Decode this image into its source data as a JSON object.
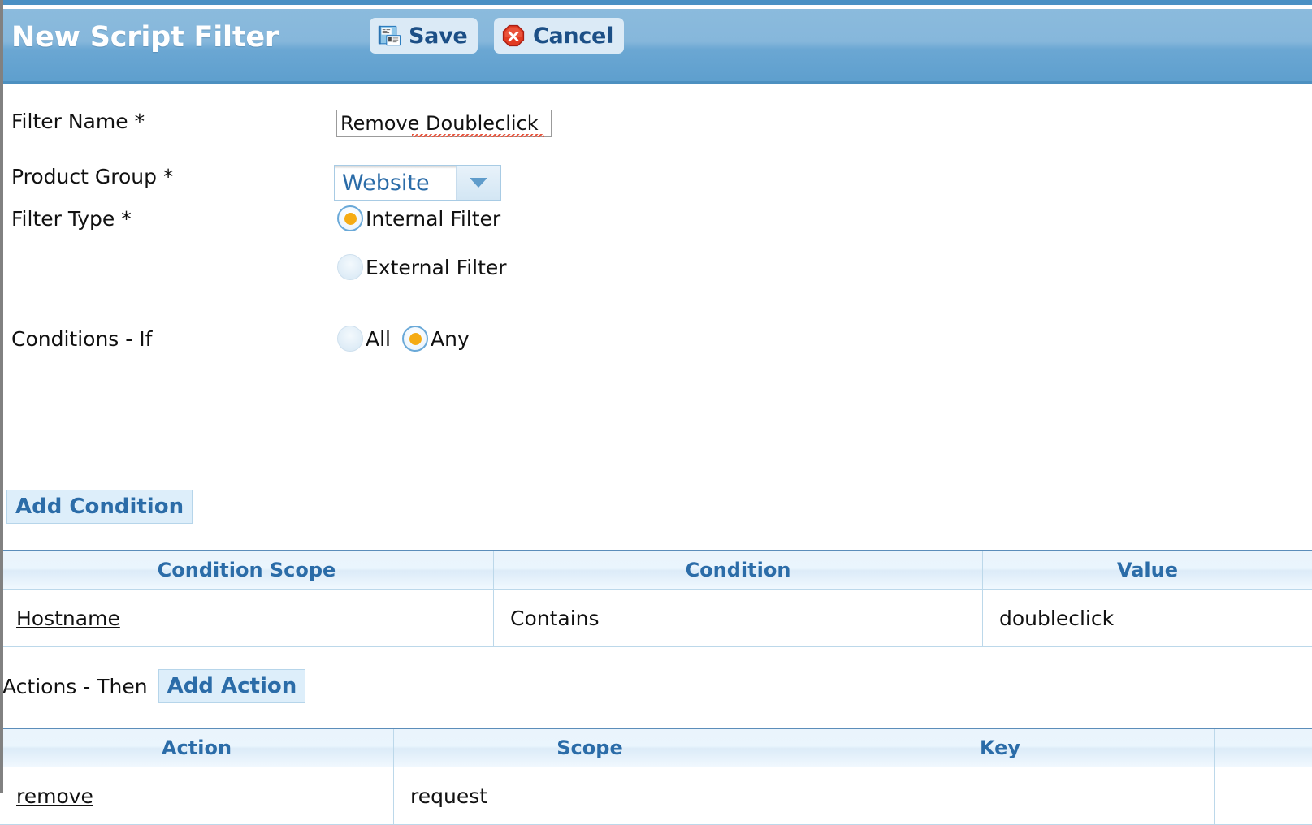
{
  "header": {
    "title": "New Script Filter",
    "save_label": "Save",
    "cancel_label": "Cancel",
    "save_icon": "save-disk-icon",
    "cancel_icon": "cancel-octagon-icon",
    "background_color": "#86b7db",
    "title_color": "#ffffff",
    "button_bg": "#dbeaf6",
    "button_text_color": "#1c4f86"
  },
  "form": {
    "filter_name": {
      "label": "Filter Name *",
      "value": "Remove Doubleclick",
      "placeholder": ""
    },
    "product_group": {
      "label": "Product Group *",
      "selected": "Website",
      "options": [
        "Website"
      ],
      "arrow_icon": "chevron-down-icon"
    },
    "filter_type": {
      "label": "Filter Type *",
      "options": [
        {
          "label": "Internal Filter",
          "selected": true
        },
        {
          "label": "External Filter",
          "selected": false
        }
      ]
    },
    "conditions_if": {
      "label": "Conditions - If",
      "options": [
        {
          "label": "All",
          "selected": false
        },
        {
          "label": "Any",
          "selected": true
        }
      ]
    },
    "add_condition_label": "Add Condition",
    "actions_then_label": "Actions - Then",
    "add_action_label": "Add Action"
  },
  "conditions_table": {
    "columns": [
      "Condition Scope",
      "Condition",
      "Value"
    ],
    "rows": [
      {
        "scope": "Hostname",
        "condition": "Contains",
        "value": "doubleclick"
      }
    ]
  },
  "actions_table": {
    "columns": [
      "Action",
      "Scope",
      "Key",
      ""
    ],
    "rows": [
      {
        "action": "remove",
        "scope": "request",
        "key": "",
        "extra": ""
      }
    ]
  },
  "theme": {
    "accent_blue": "#2b6ca8",
    "radio_selected_dot": "#f5ab13",
    "table_border": "#bcd8ea",
    "table_header_bg": "#eaf4fc",
    "spellcheck_underline": "#e8563f"
  }
}
